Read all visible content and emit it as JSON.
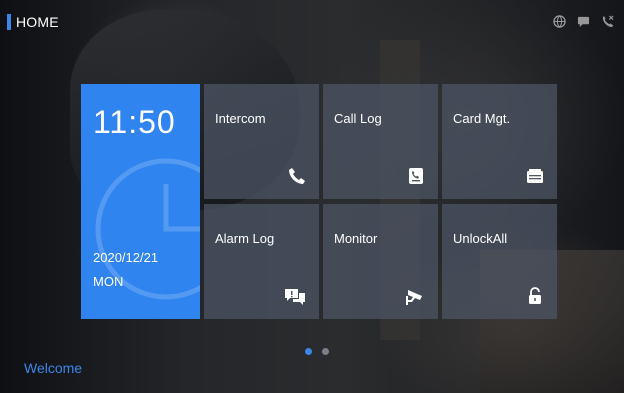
{
  "header": {
    "title": "HOME"
  },
  "status_icons": [
    "globe-icon",
    "chat-icon",
    "phone-missed-icon"
  ],
  "clock": {
    "time": "11:50",
    "date": "2020/12/21",
    "day": "MON"
  },
  "tiles": [
    {
      "label": "Intercom",
      "icon": "phone-icon"
    },
    {
      "label": "Call Log",
      "icon": "call-log-icon"
    },
    {
      "label": "Card Mgt.",
      "icon": "card-icon"
    },
    {
      "label": "Alarm Log",
      "icon": "alarm-chat-icon"
    },
    {
      "label": "Monitor",
      "icon": "camera-icon"
    },
    {
      "label": "UnlockAll",
      "icon": "unlock-icon"
    }
  ],
  "pager": {
    "current": 1,
    "total": 2
  },
  "footer": {
    "welcome": "Welcome"
  },
  "colors": {
    "accent": "#2f84f0",
    "tile": "#4e5666"
  }
}
